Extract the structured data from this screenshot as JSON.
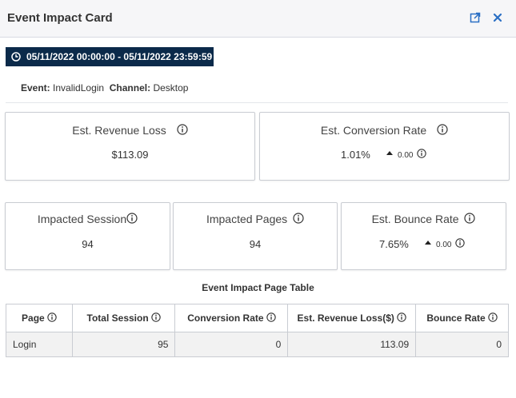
{
  "header": {
    "title": "Event Impact Card"
  },
  "date_range": "05/11/2022 00:00:00 - 05/11/2022 23:59:59",
  "event": {
    "event_label": "Event:",
    "event_value": "InvalidLogin",
    "channel_label": "Channel:",
    "channel_value": "Desktop"
  },
  "cards": {
    "revenue_loss": {
      "label": "Est. Revenue Loss",
      "value": "$113.09"
    },
    "conversion_rate": {
      "label": "Est. Conversion Rate",
      "value": "1.01%",
      "delta": "0.00"
    },
    "impacted_session": {
      "label": "Impacted Session",
      "value": "94"
    },
    "impacted_pages": {
      "label": "Impacted Pages",
      "value": "94"
    },
    "bounce_rate": {
      "label": "Est. Bounce Rate",
      "value": "7.65%",
      "delta": "0.00"
    }
  },
  "table": {
    "title": "Event Impact Page Table",
    "headers": [
      "Page",
      "Total Session",
      "Conversion Rate",
      "Est. Revenue Loss($)",
      "Bounce Rate"
    ],
    "rows": [
      [
        "Login",
        "95",
        "0",
        "113.09",
        "0"
      ]
    ]
  },
  "colors": {
    "header_bg": "#f6f6f8",
    "badge_bg": "#0b2a4a",
    "accent": "#2a6fc4",
    "border": "#c9ccd2"
  }
}
